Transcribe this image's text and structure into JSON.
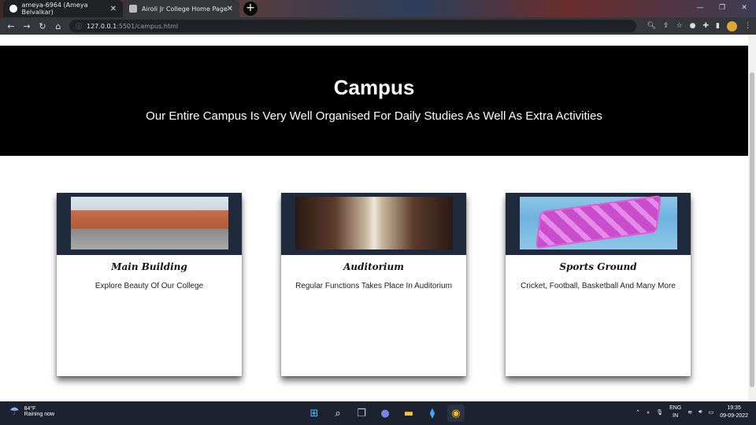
{
  "browser": {
    "tabs": [
      {
        "title": "ameya-6964 (Ameya Belvalkar)",
        "active": true
      },
      {
        "title": "Airoli Jr College Home Page",
        "active": false
      }
    ],
    "new_tab_symbol": "+",
    "address": {
      "host": "127.0.0.1",
      "path": ":5501/campus.html"
    }
  },
  "page": {
    "hero": {
      "title": "Campus",
      "subtitle": "Our Entire Campus Is Very Well Organised For Daily Studies As Well As Extra Activities"
    },
    "cards": [
      {
        "title": "Main Building",
        "description": "Explore Beauty Of Our College"
      },
      {
        "title": "Auditorium",
        "description": "Regular Functions Takes Place In Auditorium"
      },
      {
        "title": "Sports Ground",
        "description": "Cricket, Football, Basketball And Many More"
      }
    ]
  },
  "taskbar": {
    "weather": {
      "temp": "84°F",
      "condition": "Raining now"
    },
    "language": {
      "line1": "ENG",
      "line2": "IN"
    },
    "clock": {
      "time": "19:35",
      "date": "09-09-2022"
    }
  }
}
